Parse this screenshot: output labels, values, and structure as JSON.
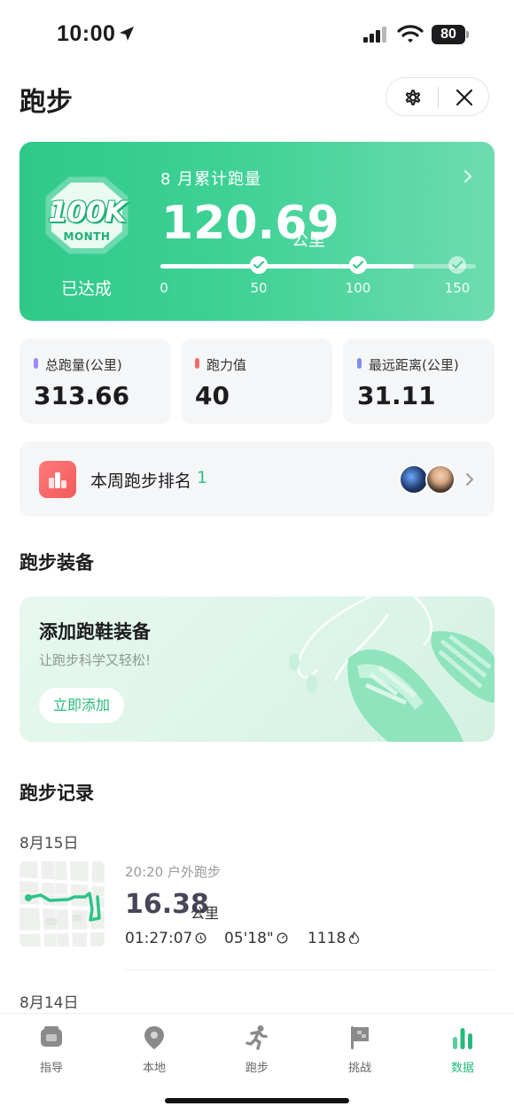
{
  "status_bar": {
    "time": "10:00",
    "battery": "80"
  },
  "header": {
    "title": "跑步"
  },
  "monthly": {
    "label": "8 月累计跑量",
    "value": "120.69",
    "unit": "公里",
    "badge_big": "100K",
    "badge_small": "MONTH",
    "achieved": "已达成",
    "progress_km": 120.69,
    "progress_max_km": 150,
    "ticks": [
      "0",
      "50",
      "100",
      "150"
    ]
  },
  "stats": [
    {
      "label": "总跑量(公里)",
      "value": "313.66",
      "color": "#9b8cf5"
    },
    {
      "label": "跑力值",
      "value": "40",
      "color": "#f26b6b"
    },
    {
      "label": "最远距离(公里)",
      "value": "31.11",
      "color": "#7d8ff0"
    }
  ],
  "ranking": {
    "label": "本周跑步排名",
    "value": "1"
  },
  "equipment": {
    "section_title": "跑步装备",
    "title": "添加跑鞋装备",
    "subtitle": "让跑步科学又轻松!",
    "button": "立即添加"
  },
  "records": {
    "section_title": "跑步记录",
    "groups": [
      {
        "date": "8月15日",
        "items": [
          {
            "time_type": "20:20 户外跑步",
            "distance": "16.38",
            "unit": "公里",
            "duration": "01:27:07",
            "pace": "05'18\"",
            "calories": "1118"
          }
        ]
      },
      {
        "date": "8月14日"
      }
    ]
  },
  "tabs": [
    {
      "label": "指导",
      "icon": "guide-icon",
      "active": false
    },
    {
      "label": "本地",
      "icon": "location-pin-icon",
      "active": false
    },
    {
      "label": "跑步",
      "icon": "runner-icon",
      "active": false
    },
    {
      "label": "挑战",
      "icon": "flag-icon",
      "active": false
    },
    {
      "label": "数据",
      "icon": "bar-chart-icon",
      "active": true
    }
  ],
  "colors": {
    "accent": "#2cc485",
    "hero_start": "#2ec98a",
    "hero_end": "#6ddcaf"
  }
}
